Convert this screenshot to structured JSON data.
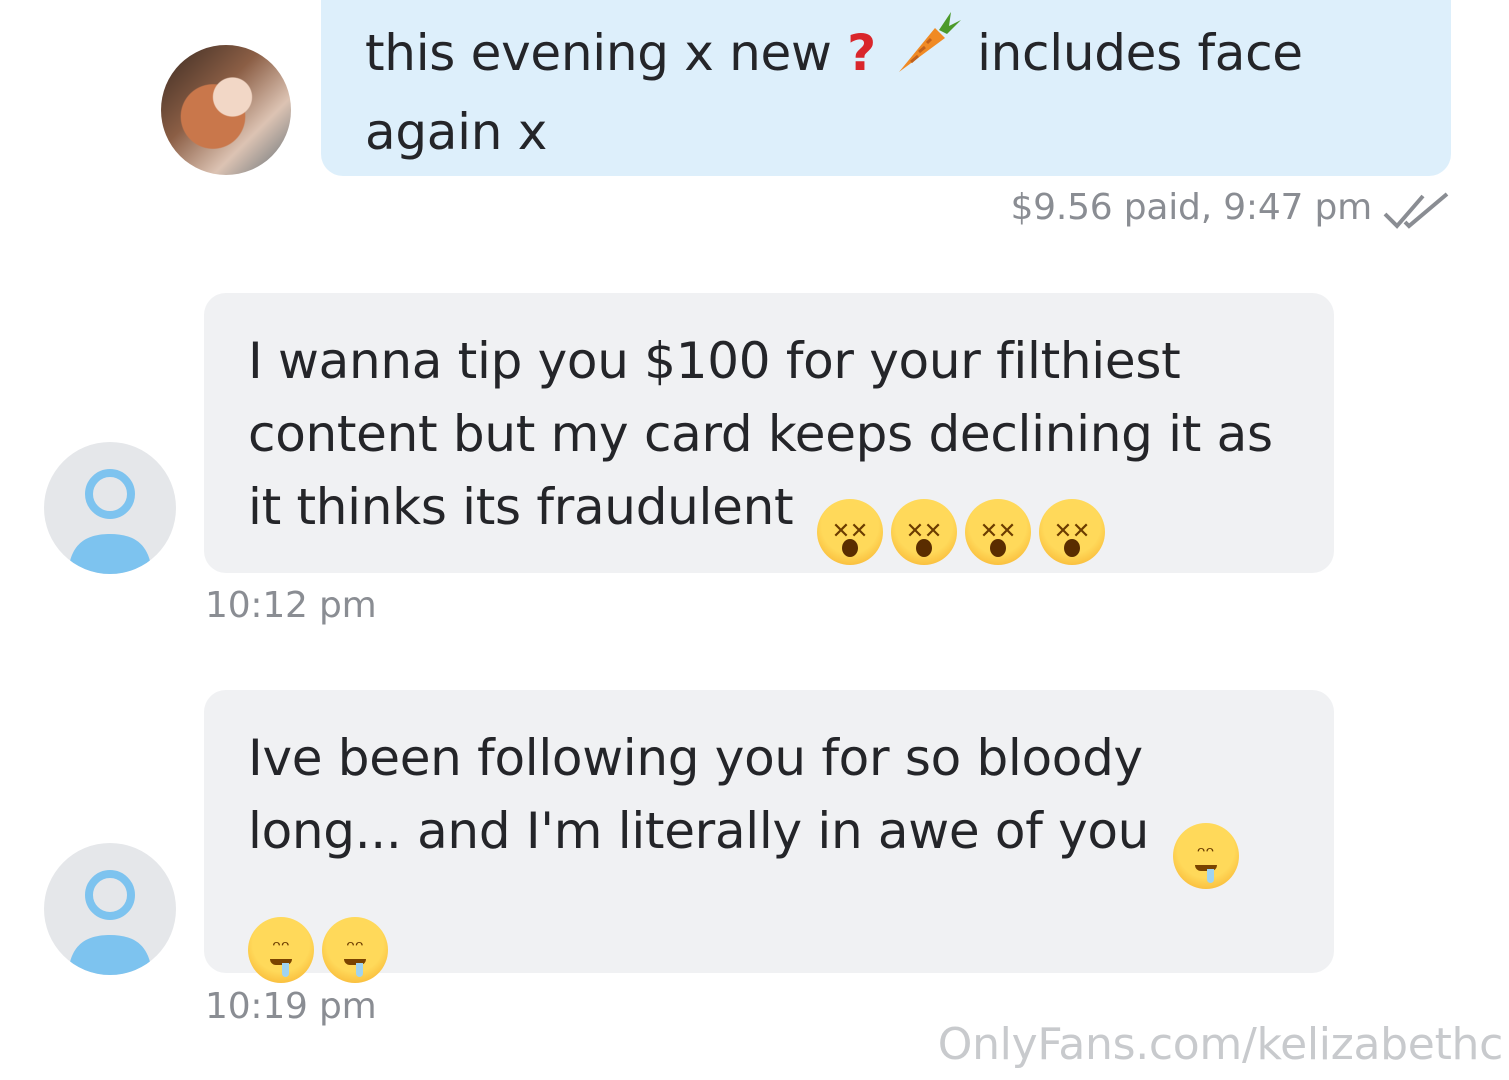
{
  "messages": [
    {
      "direction": "outgoing",
      "line1_before": "this evening x new",
      "q_icon": "question-mark",
      "carrot_icon": "carrot",
      "line1_after": "includes face",
      "line2": "again x",
      "meta": "$9.56 paid, 9:47 pm",
      "status_icon": "double-check"
    },
    {
      "direction": "incoming",
      "lines": [
        "I wanna tip you $100 for your filthiest",
        "content but my card keeps declining it as",
        "it thinks its fraudulent"
      ],
      "emoji": "dizzy-face",
      "emoji_count": 4,
      "time": "10:12 pm"
    },
    {
      "direction": "incoming",
      "lines": [
        "Ive been following you for so bloody",
        "long... and I'm literally in awe of you"
      ],
      "emoji": "drooling-face",
      "emoji_count": 3,
      "time": "10:19 pm"
    }
  ],
  "watermark": "OnlyFans.com/kelizabethc",
  "colors": {
    "outgoing_bubble": "#ddeffb",
    "incoming_bubble": "#f0f1f3",
    "meta_text": "#8a8d93",
    "avatar_icon": "#7dc3ef"
  }
}
